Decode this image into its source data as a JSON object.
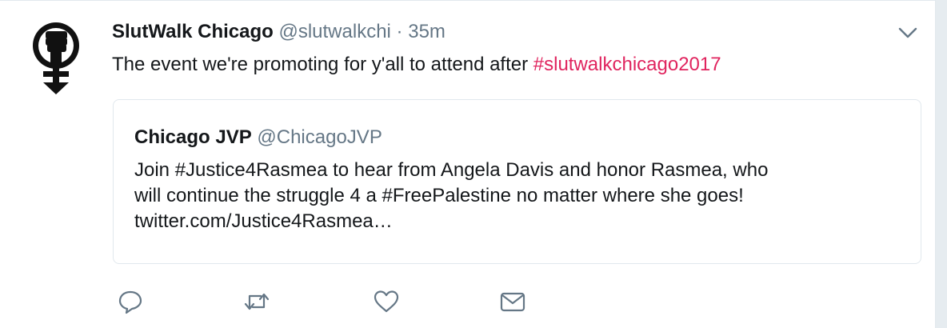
{
  "tweet": {
    "author_name": "SlutWalk Chicago",
    "author_handle": "@slutwalkchi",
    "separator": "·",
    "timestamp": "35m",
    "text_before": "The event we're promoting for y'all to attend after ",
    "hashtag": "#slutwalkchicago2017",
    "avatar_icon": "raised-fist-venus-icon",
    "hashtag_color": "#e0245e"
  },
  "quoted_tweet": {
    "author_name": "Chicago JVP",
    "author_handle": "@ChicagoJVP",
    "lines": [
      "Join #Justice4Rasmea to hear from Angela Davis and honor Rasmea, who",
      "will continue the struggle 4 a #FreePalestine no matter where she goes!",
      "twitter.com/Justice4Rasmea…"
    ]
  },
  "actions": {
    "icons": [
      "reply-icon",
      "retweet-icon",
      "like-icon",
      "direct-message-icon"
    ],
    "icon_color": "#657786"
  },
  "menu": {
    "icon": "chevron-down-icon"
  }
}
